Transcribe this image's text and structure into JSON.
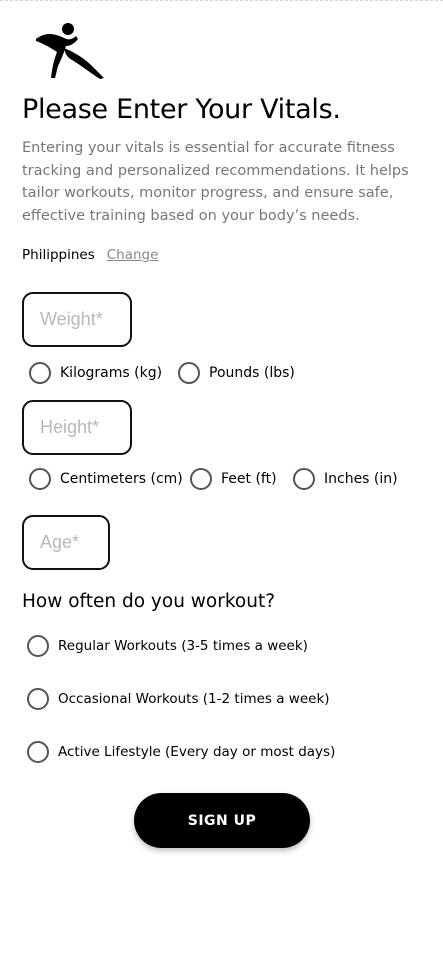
{
  "page": {
    "title": "Please Enter Your Vitals.",
    "description": "Entering your vitals is essential for accurate fitness tracking and personalized recommendations. It helps tailor workouts, monitor progress, and ensure safe, effective training based on your body’s needs."
  },
  "country": {
    "name": "Philippines",
    "change_label": "Change"
  },
  "weight": {
    "placeholder": "Weight*",
    "units": [
      "Kilograms (kg)",
      "Pounds (lbs)"
    ]
  },
  "height": {
    "placeholder": "Height*",
    "units": [
      "Centimeters (cm)",
      "Feet (ft)",
      "Inches (in)"
    ]
  },
  "age": {
    "placeholder": "Age*"
  },
  "workout": {
    "question": "How often do you workout?",
    "options": [
      "Regular Workouts (3-5 times a week)",
      "Occasional Workouts (1-2 times a week)",
      "Active Lifestyle (Every day or most days)"
    ]
  },
  "signup_label": "SIGN UP",
  "icons": {
    "logo": "running-figure-logo-icon"
  },
  "colors": {
    "primary": "#000000",
    "muted_text": "#777777",
    "placeholder": "#b8b8b8"
  }
}
